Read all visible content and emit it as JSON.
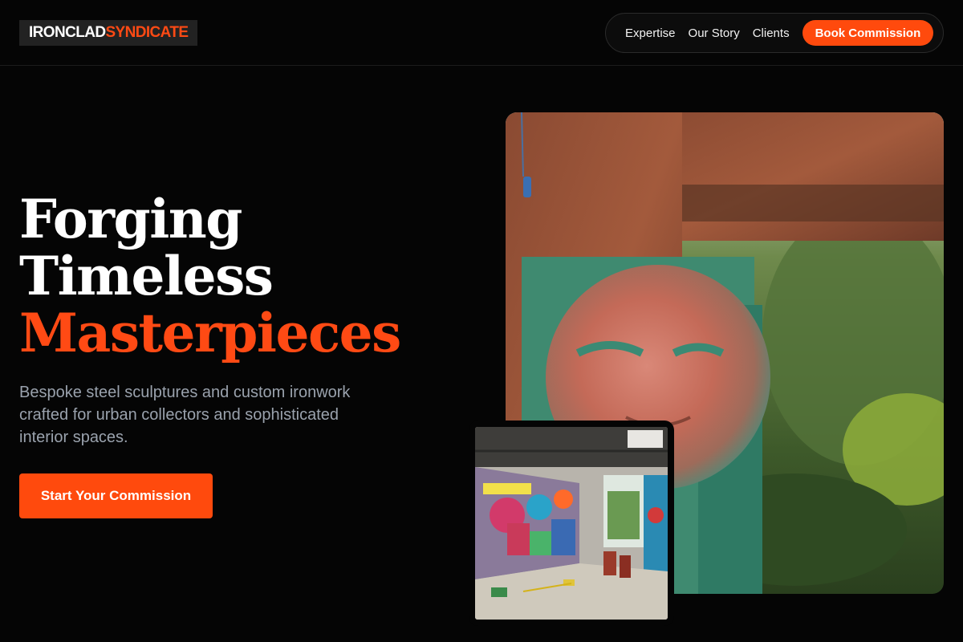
{
  "brand": {
    "part1": "IRONCLAD",
    "part2": "SYNDICATE"
  },
  "nav": {
    "links": [
      "Expertise",
      "Our Story",
      "Clients"
    ],
    "cta": "Book Commission"
  },
  "hero": {
    "line1": "Forging",
    "line2": "Timeless",
    "line3": "Masterpieces",
    "subtitle": "Bespoke steel sculptures and custom ironwork crafted for urban collectors and sophisticated interior spaces.",
    "cta": "Start Your Commission"
  },
  "colors": {
    "accent": "#ff4a0d",
    "background": "#050505",
    "muted_text": "#9aa2ad"
  }
}
